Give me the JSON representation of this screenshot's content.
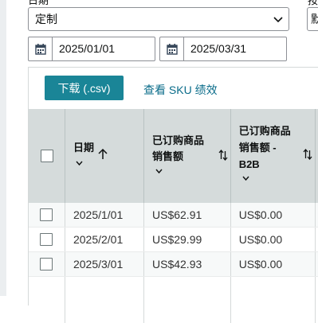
{
  "filters": {
    "date_label_clipped": "日期",
    "right_label_clipped": "按",
    "date_range_select": {
      "value": "定制"
    },
    "second_select": {
      "value": "默"
    },
    "start_date": "2025/01/01",
    "end_date": "2025/03/31"
  },
  "toolbar": {
    "download_label": "下载 (.csv)",
    "sku_link_label": "查看 SKU 绩效"
  },
  "table": {
    "headers": [
      {
        "lines": [
          "日期"
        ]
      },
      {
        "lines": [
          "已订购商品",
          "销售额"
        ]
      },
      {
        "lines": [
          "已订购商品",
          "销售额 -",
          "B2B"
        ]
      }
    ],
    "rows": [
      {
        "date": "2025/1/01",
        "sales": "US$62.91",
        "sales_b2b": "US$0.00"
      },
      {
        "date": "2025/2/01",
        "sales": "US$29.99",
        "sales_b2b": "US$0.00"
      },
      {
        "date": "2025/3/01",
        "sales": "US$42.93",
        "sales_b2b": "US$0.00"
      }
    ]
  },
  "colors": {
    "button_teal": "#1a8597",
    "link_blue": "#0a6c8a",
    "header_bg": "#d5dbdb"
  }
}
